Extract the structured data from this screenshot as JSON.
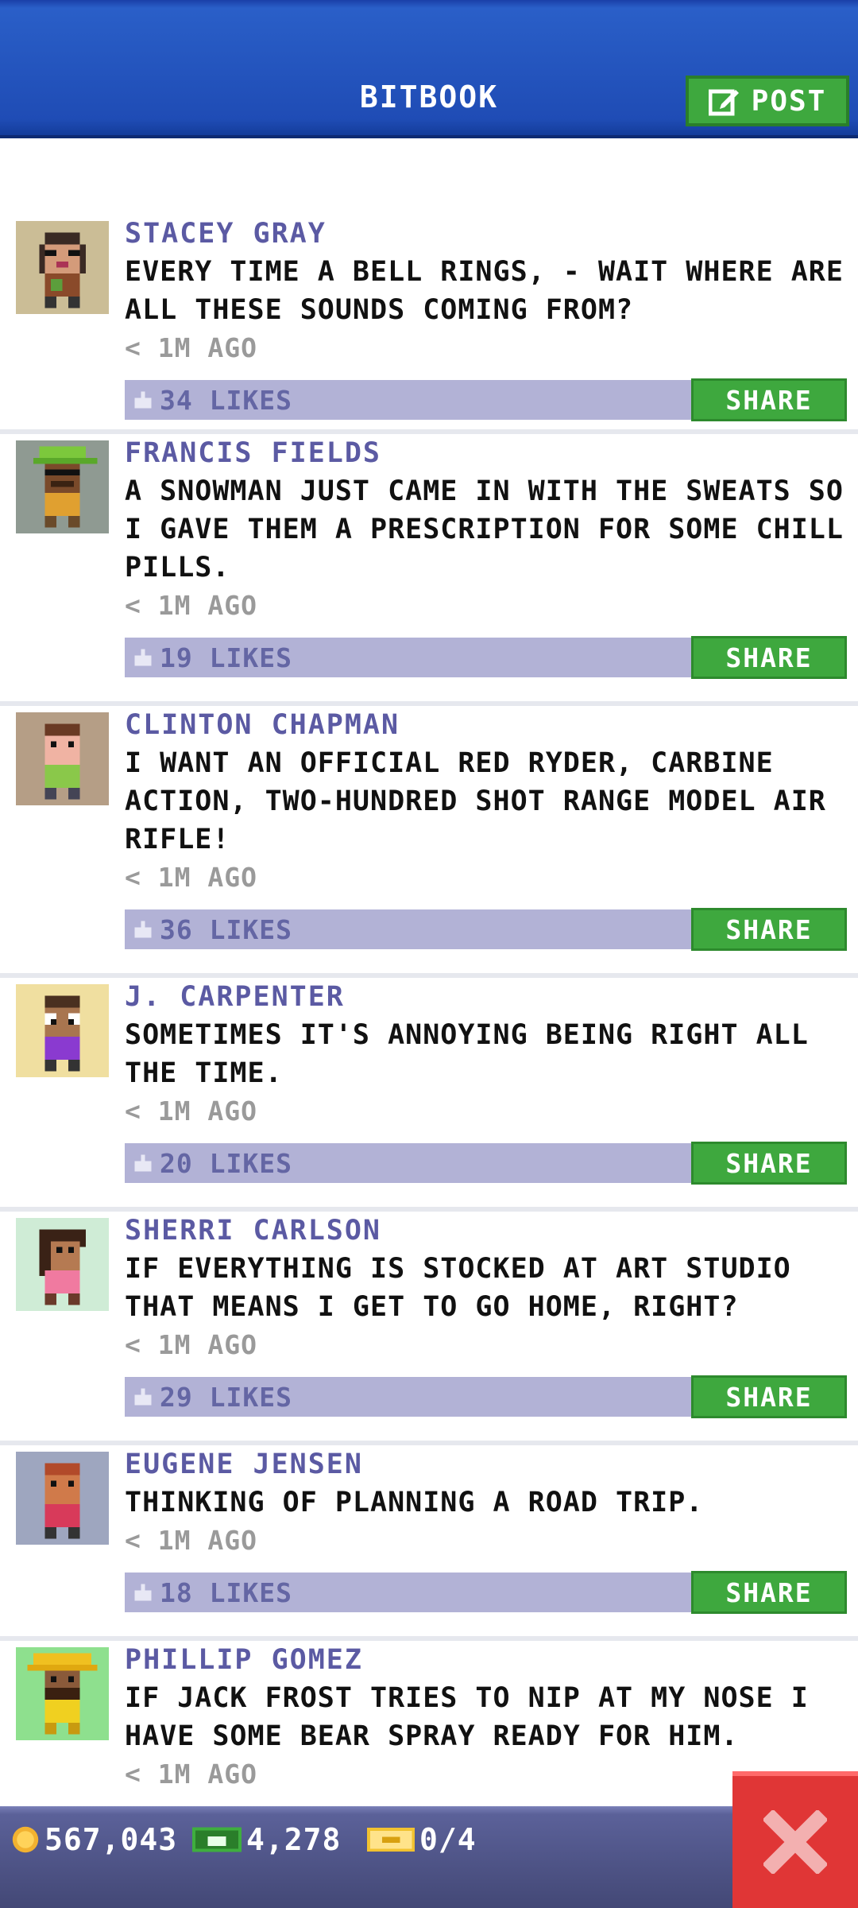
{
  "header": {
    "title": "BITBOOK",
    "post_label": "POST"
  },
  "posts": [
    {
      "author": "STACEY GRAY",
      "message": "EVERY TIME A BELL RINGS, - WAIT WHERE ARE ALL THESE SOUNDS COMING FROM?",
      "time": "< 1M AGO",
      "likes": "34 LIKES",
      "share_label": "SHARE"
    },
    {
      "author": "FRANCIS FIELDS",
      "message": "A SNOWMAN JUST CAME IN WITH THE SWEATS SO I GAVE THEM A PRESCRIPTION FOR SOME CHILL PILLS.",
      "time": "< 1M AGO",
      "likes": "19 LIKES",
      "share_label": "SHARE"
    },
    {
      "author": "CLINTON CHAPMAN",
      "message": "I WANT AN OFFICIAL RED RYDER, CARBINE ACTION, TWO-HUNDRED SHOT RANGE MODEL AIR RIFLE!",
      "time": "< 1M AGO",
      "likes": "36 LIKES",
      "share_label": "SHARE"
    },
    {
      "author": "J. CARPENTER",
      "message": "SOMETIMES IT'S ANNOYING BEING RIGHT ALL THE TIME.",
      "time": "< 1M AGO",
      "likes": "20 LIKES",
      "share_label": "SHARE"
    },
    {
      "author": "SHERRI CARLSON",
      "message": "IF EVERYTHING IS STOCKED AT ART STUDIO THAT MEANS I GET TO GO HOME, RIGHT?",
      "time": "< 1M AGO",
      "likes": "29 LIKES",
      "share_label": "SHARE"
    },
    {
      "author": "EUGENE JENSEN",
      "message": "THINKING OF PLANNING A ROAD TRIP.",
      "time": "< 1M AGO",
      "likes": "18 LIKES",
      "share_label": "SHARE"
    },
    {
      "author": "PHILLIP GOMEZ",
      "message": "IF JACK FROST TRIES TO NIP AT MY NOSE I HAVE SOME BEAR SPRAY READY FOR HIM.",
      "time": "< 1M AGO"
    }
  ],
  "bottom_bar": {
    "coins": "567,043",
    "bux": "4,278",
    "tickets": "0/4"
  },
  "icons": {
    "post": "edit-icon",
    "like": "thumbs-up-icon",
    "coins": "coin-icon",
    "bux": "bux-icon",
    "tickets": "ticket-icon",
    "close": "close-icon"
  },
  "colors": {
    "header": "#1f4cb5",
    "accent_green": "#3ea83e",
    "likes_bar": "#b2b2d6",
    "author_text": "#5b5aa3",
    "close_red": "#e03636"
  }
}
